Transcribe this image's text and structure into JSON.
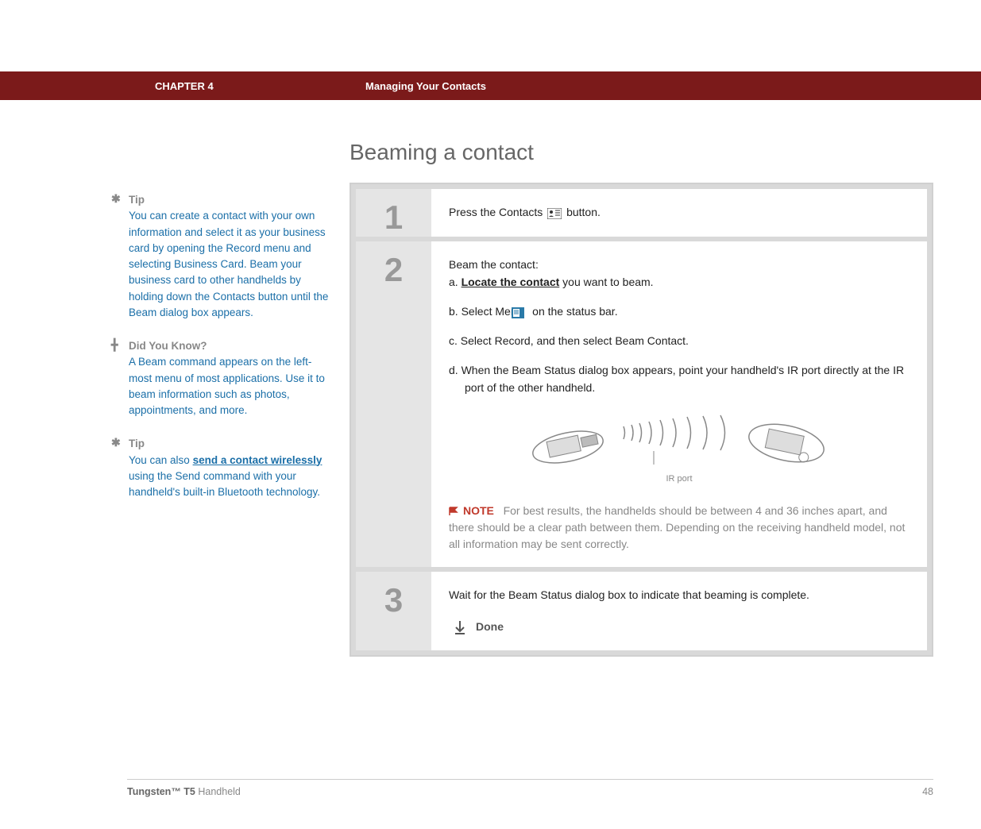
{
  "header": {
    "chapter": "CHAPTER 4",
    "title": "Managing Your Contacts"
  },
  "main_title": "Beaming a contact",
  "sidebar": {
    "tip1": {
      "heading": "Tip",
      "text": "You can create a contact with your own information and select it as your business card by opening the Record menu and selecting Business Card. Beam your business card to other handhelds by holding down the Contacts button until the Beam dialog box appears."
    },
    "dyk": {
      "heading": "Did You Know?",
      "text": "A Beam command appears on the left-most menu of most applications. Use it to beam information such as photos, appointments, and more."
    },
    "tip2": {
      "heading": "Tip",
      "text_before": "You can also ",
      "link": "send a contact wirelessly",
      "text_after": " using the Send command with your handheld's built-in Bluetooth technology."
    }
  },
  "steps": {
    "s1": {
      "num": "1",
      "text_before": "Press the Contacts ",
      "text_after": " button."
    },
    "s2": {
      "num": "2",
      "intro": "Beam the contact:",
      "a_prefix": "a.  ",
      "a_link": "Locate the contact",
      "a_after": " you want to beam.",
      "b_prefix": "b.  Select Menu ",
      "b_after": " on the status bar.",
      "c": "c.  Select Record, and then select Beam Contact.",
      "d": "d.  When the Beam Status dialog box appears, point your handheld's IR port directly at the IR port of the other handheld.",
      "ir_label": "IR port",
      "note_label": "NOTE",
      "note_text": "For best results, the handhelds should be between 4 and 36 inches apart, and there should be a clear path between them. Depending on the receiving handheld model, not all information may be sent correctly."
    },
    "s3": {
      "num": "3",
      "text": "Wait for the Beam Status dialog box to indicate that beaming is complete.",
      "done": "Done"
    }
  },
  "footer": {
    "product_bold": "Tungsten™ T5",
    "product_rest": " Handheld",
    "page": "48"
  }
}
